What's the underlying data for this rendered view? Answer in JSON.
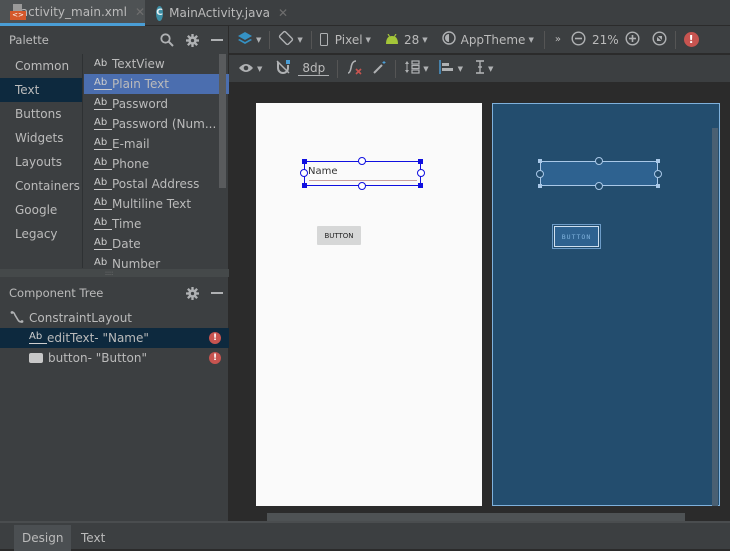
{
  "editor_tabs": [
    {
      "label": "activity_main.xml",
      "icon": "xml-layout-icon",
      "active": true
    },
    {
      "label": "MainActivity.java",
      "icon": "java-class-icon",
      "active": false
    }
  ],
  "palette": {
    "title": "Palette",
    "categories": [
      "Common",
      "Text",
      "Buttons",
      "Widgets",
      "Layouts",
      "Containers",
      "Google",
      "Legacy"
    ],
    "selected_category": "Text",
    "widgets": [
      {
        "label": "TextView",
        "icon": "Ab"
      },
      {
        "label": "Plain Text",
        "icon": "Ab",
        "selected": true
      },
      {
        "label": "Password",
        "icon": "Ab"
      },
      {
        "label": "Password (Num...",
        "icon": "Ab"
      },
      {
        "label": "E-mail",
        "icon": "Ab"
      },
      {
        "label": "Phone",
        "icon": "Ab"
      },
      {
        "label": "Postal Address",
        "icon": "Ab"
      },
      {
        "label": "Multiline Text",
        "icon": "Ab"
      },
      {
        "label": "Time",
        "icon": "Ab"
      },
      {
        "label": "Date",
        "icon": "Ab"
      },
      {
        "label": "Number",
        "icon": "Ab"
      }
    ]
  },
  "component_tree": {
    "title": "Component Tree",
    "root": "ConstraintLayout",
    "items": [
      {
        "label": "editText- \"Name\"",
        "icon": "Ab",
        "selected": true,
        "error": true
      },
      {
        "label": "button- \"Button\"",
        "icon": "button-widget",
        "selected": false,
        "error": true
      }
    ]
  },
  "toolbar": {
    "device": "Pixel",
    "api_level": "28",
    "theme": "AppTheme",
    "zoom": "21%",
    "margin": "8dp",
    "overflow": "»"
  },
  "design": {
    "edittext_hint": "Name",
    "button_label": "BUTTON"
  },
  "bottom_tabs": [
    {
      "label": "Design",
      "active": true
    },
    {
      "label": "Text",
      "active": false
    }
  ],
  "colors": {
    "accent": "#4a9ed6",
    "selection": "#4b6eaf",
    "error": "#c75450",
    "blueprint": "#234d6e",
    "android_green": "#a4c639"
  }
}
